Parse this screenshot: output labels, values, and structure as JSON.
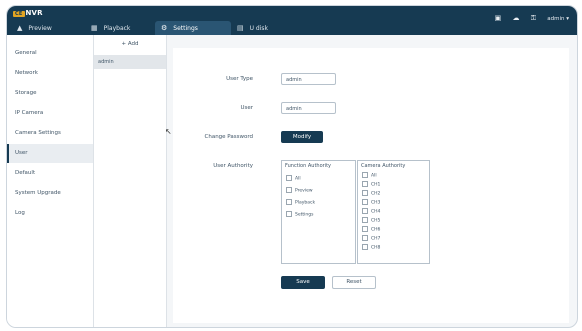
{
  "app": {
    "logo_badge": "CE",
    "logo_text": "NVR"
  },
  "tabs": [
    {
      "icon": "▲",
      "label": "Preview"
    },
    {
      "icon": "▦",
      "label": "Playback"
    },
    {
      "icon": "⚙",
      "label": "Settings"
    },
    {
      "icon": "▤",
      "label": "U disk"
    }
  ],
  "topbar_right": {
    "user_label": "admin ▾"
  },
  "sidebar": {
    "items": [
      "General",
      "Network",
      "Storage",
      "IP Camera",
      "Camera Settings",
      "User",
      "Default",
      "System Upgrade",
      "Log"
    ],
    "active_index": 5
  },
  "user_list": {
    "add_label": "+ Add",
    "users": [
      "admin"
    ]
  },
  "form": {
    "user_type_label": "User Type",
    "user_type_value": "admin",
    "user_label": "User",
    "user_value": "admin",
    "change_password_label": "Change Password",
    "modify_button": "Modify",
    "user_authority_label": "User Authority",
    "function_authority": {
      "title": "Function Authority",
      "items": [
        "All",
        "Preview",
        "Playback",
        "Settings"
      ]
    },
    "camera_authority": {
      "title": "Camera Authority",
      "items": [
        "All",
        "CH1",
        "CH2",
        "CH3",
        "CH4",
        "CH5",
        "CH6",
        "CH7",
        "CH8"
      ]
    },
    "save_button": "Save",
    "reset_button": "Reset"
  },
  "colors": {
    "primary": "#163a52",
    "accent": "#e2a422"
  }
}
